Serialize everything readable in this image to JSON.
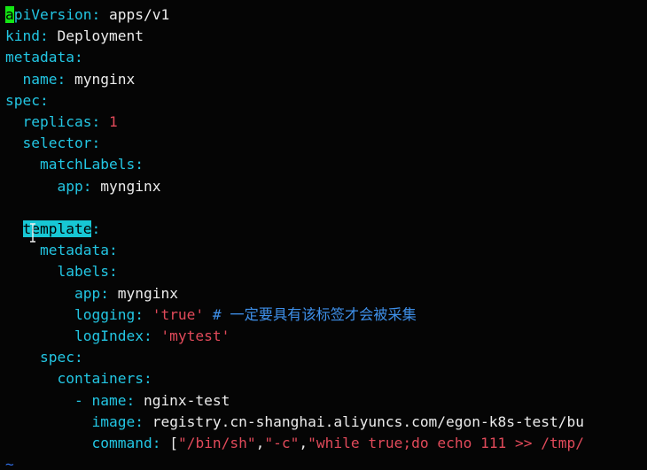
{
  "lines": [
    {
      "indent": "",
      "cursor": "a",
      "key": "piVersion",
      "colon": ":",
      "value": " apps/v1"
    },
    {
      "indent": "",
      "key": "kind",
      "colon": ":",
      "value": " Deployment"
    },
    {
      "indent": "",
      "key": "metadata",
      "colon": ":"
    },
    {
      "indent": "  ",
      "key": "name",
      "colon": ":",
      "value": " mynginx"
    },
    {
      "indent": "",
      "key": "spec",
      "colon": ":"
    },
    {
      "indent": "  ",
      "key": "replicas",
      "colon": ":",
      "num": " 1"
    },
    {
      "indent": "  ",
      "key": "selector",
      "colon": ":"
    },
    {
      "indent": "    ",
      "key": "matchLabels",
      "colon": ":"
    },
    {
      "indent": "      ",
      "key": "app",
      "colon": ":",
      "value": " mynginx"
    },
    {
      "indent": "",
      "blank": true
    },
    {
      "indent": "  ",
      "hl": "template",
      "colon": ":"
    },
    {
      "indent": "    ",
      "key": "metadata",
      "colon": ":"
    },
    {
      "indent": "      ",
      "key": "labels",
      "colon": ":"
    },
    {
      "indent": "        ",
      "key": "app",
      "colon": ":",
      "value": " mynginx"
    },
    {
      "indent": "        ",
      "key": "logging",
      "colon": ":",
      "str": " 'true'",
      "comment": " # 一定要具有该标签才会被采集"
    },
    {
      "indent": "        ",
      "key": "logIndex",
      "colon": ":",
      "str": " 'mytest'"
    },
    {
      "indent": "    ",
      "key": "spec",
      "colon": ":"
    },
    {
      "indent": "      ",
      "key": "containers",
      "colon": ":"
    },
    {
      "indent": "        ",
      "dash": "- ",
      "key": "name",
      "colon": ":",
      "value": " nginx-test"
    },
    {
      "indent": "          ",
      "key": "image",
      "colon": ":",
      "value": " registry.cn-shanghai.aliyuncs.com/egon-k8s-test/bu"
    },
    {
      "indent": "          ",
      "key": "command",
      "colon": ":",
      "value": " [",
      "strs": "\"/bin/sh\"",
      "sep1": ",",
      "strs2": "\"-c\"",
      "sep2": ",",
      "strs3": "\"while true;do echo 111 >> /tmp/"
    }
  ],
  "tilde": "~",
  "colors": {
    "key": "#23c6e3",
    "string": "#e14a5a",
    "comment": "#3e8fe8",
    "cursor": "#14e614",
    "search_highlight": "#17c7d4",
    "background": "#050505"
  }
}
